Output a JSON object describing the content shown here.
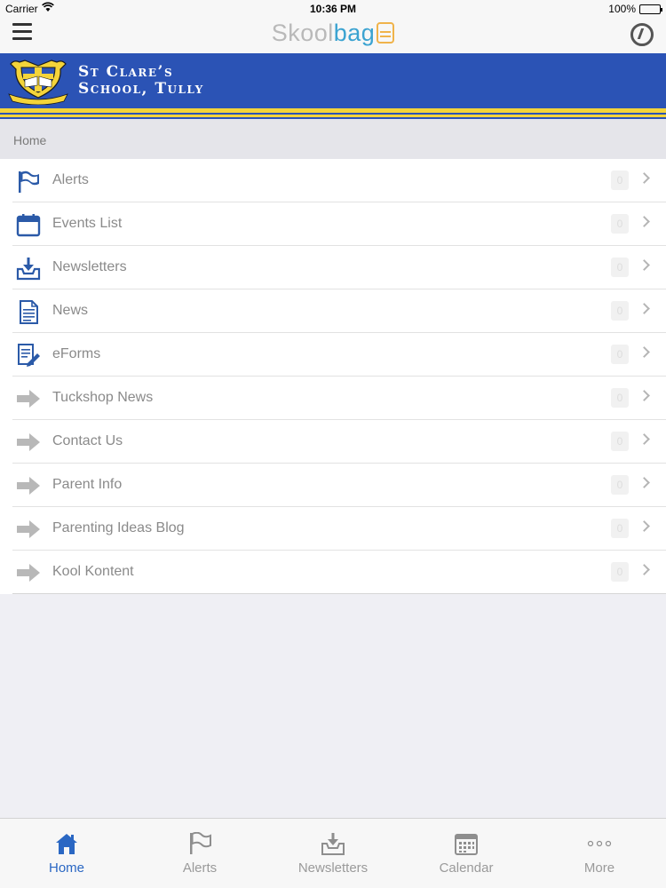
{
  "status_bar": {
    "carrier": "Carrier",
    "time": "10:36 PM",
    "battery": "100%"
  },
  "app": {
    "brand_part1": "Skool",
    "brand_part2": "bag",
    "brand_icon": "bag-icon"
  },
  "school": {
    "name_line1": "St Clare’s",
    "name_line2": "School, Tully",
    "crest_motto": "FAITH AND KNOWLEDGE"
  },
  "breadcrumb": "Home",
  "menu_items": [
    {
      "label": "Alerts",
      "icon": "flag-icon",
      "badge": "0"
    },
    {
      "label": "Events List",
      "icon": "calendar-icon",
      "badge": "0"
    },
    {
      "label": "Newsletters",
      "icon": "inbox-download-icon",
      "badge": "0"
    },
    {
      "label": "News",
      "icon": "document-icon",
      "badge": "0"
    },
    {
      "label": "eForms",
      "icon": "form-pencil-icon",
      "badge": "0"
    },
    {
      "label": "Tuckshop News",
      "icon": "arrow-right-icon",
      "badge": "0"
    },
    {
      "label": "Contact Us",
      "icon": "arrow-right-icon",
      "badge": "0"
    },
    {
      "label": "Parent Info",
      "icon": "arrow-right-icon",
      "badge": "0"
    },
    {
      "label": "Parenting Ideas Blog",
      "icon": "arrow-right-icon",
      "badge": "0"
    },
    {
      "label": "Kool Kontent",
      "icon": "arrow-right-icon",
      "badge": "0"
    }
  ],
  "tabs": [
    {
      "label": "Home",
      "icon": "home-icon",
      "active": true
    },
    {
      "label": "Alerts",
      "icon": "flag-icon",
      "active": false
    },
    {
      "label": "Newsletters",
      "icon": "inbox-download-icon",
      "active": false
    },
    {
      "label": "Calendar",
      "icon": "calendar-icon",
      "active": false
    },
    {
      "label": "More",
      "icon": "more-dots-icon",
      "active": false
    }
  ],
  "colors": {
    "banner_blue": "#2b53b5",
    "banner_gold": "#f4d43a",
    "icon_blue": "#2b5aa8",
    "tab_active": "#2a67c3",
    "arrow_gray": "#b8b8b8"
  }
}
